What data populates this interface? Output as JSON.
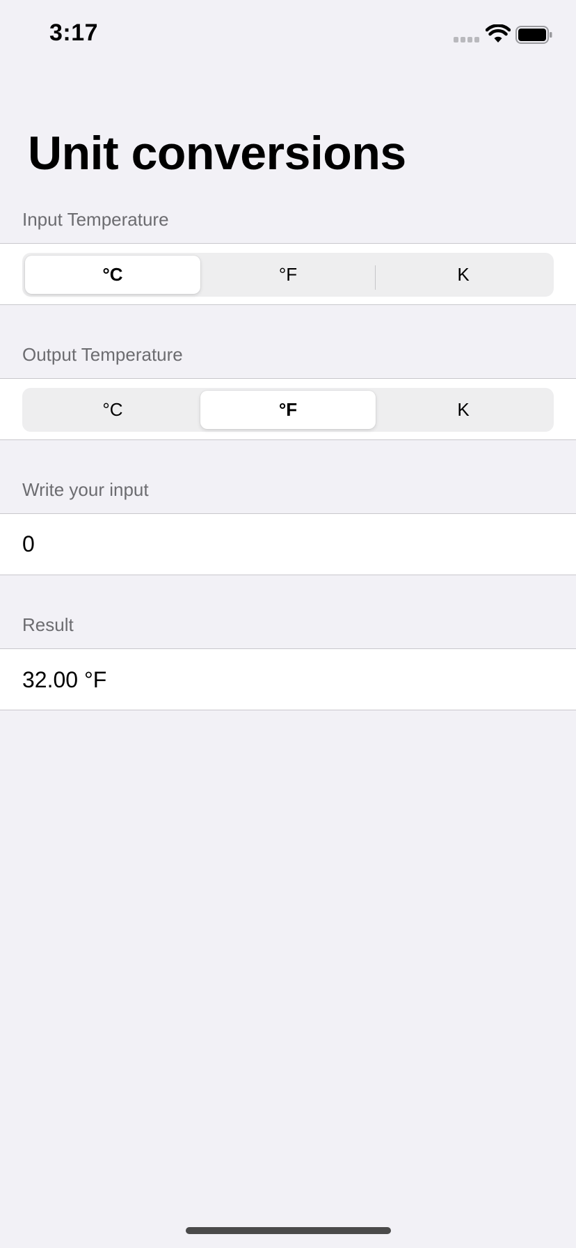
{
  "status_bar": {
    "time": "3:17"
  },
  "title": "Unit conversions",
  "input_section": {
    "header": "Input Temperature",
    "options": [
      "°C",
      "°F",
      "K"
    ],
    "selected": "°C"
  },
  "output_section": {
    "header": "Output Temperature",
    "options": [
      "°C",
      "°F",
      "K"
    ],
    "selected": "°F"
  },
  "input_field": {
    "header": "Write your input",
    "value": "0"
  },
  "result": {
    "header": "Result",
    "value": "32.00 °F"
  },
  "colors": {
    "background": "#f2f1f6",
    "card": "#ffffff",
    "secondary_text": "#6c6c70",
    "segment_track": "#eeeeef"
  }
}
